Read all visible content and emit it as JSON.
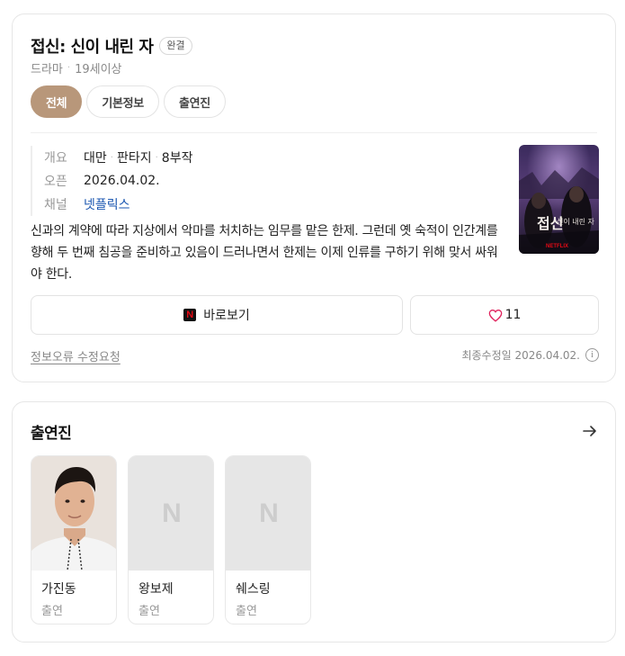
{
  "program": {
    "title": "접신: 신이 내린 자",
    "status_badge": "완결",
    "genre": "드라마",
    "rating": "19세이상"
  },
  "tabs": [
    {
      "label": "전체",
      "active": true
    },
    {
      "label": "기본정보",
      "active": false
    },
    {
      "label": "출연진",
      "active": false
    }
  ],
  "info": {
    "overview_label": "개요",
    "overview_country": "대만",
    "overview_genre": "판타지",
    "overview_episodes": "8부작",
    "open_label": "오픈",
    "open_date": "2026.04.02.",
    "channel_label": "채널",
    "channel_name": "넷플릭스"
  },
  "poster": {
    "title_text": "접신",
    "subtitle_text": "신이 내린 자",
    "logo": "NETFLIX",
    "icon": "poster-image"
  },
  "description": "신과의 계약에 따라 지상에서 악마를 처치하는 임무를 맡은 한제. 그런데 옛 숙적이 인간계를 향해 두 번째 침공을 준비하고 있음이 드러나면서 한제는 이제 인류를 구하기 위해 맞서 싸워야 한다.",
  "actions": {
    "watch_label": "바로보기",
    "watch_icon": "netflix-icon",
    "like_count": "11",
    "like_icon": "heart-icon"
  },
  "footer": {
    "report_link": "정보오류 수정요청",
    "updated_text": "최종수정일 2026.04.02.",
    "info_icon": "info-icon"
  },
  "cast_section": {
    "title": "출연진",
    "more_icon": "arrow-right-icon",
    "members": [
      {
        "name": "가진동",
        "role": "출연",
        "has_photo": true
      },
      {
        "name": "왕보제",
        "role": "출연",
        "has_photo": false
      },
      {
        "name": "쉐스링",
        "role": "출연",
        "has_photo": false
      }
    ],
    "placeholder_letter": "N"
  },
  "colors": {
    "accent": "#b8977a",
    "link": "#1a56b0",
    "heart": "#e0245e",
    "netflix_red": "#e50914"
  }
}
